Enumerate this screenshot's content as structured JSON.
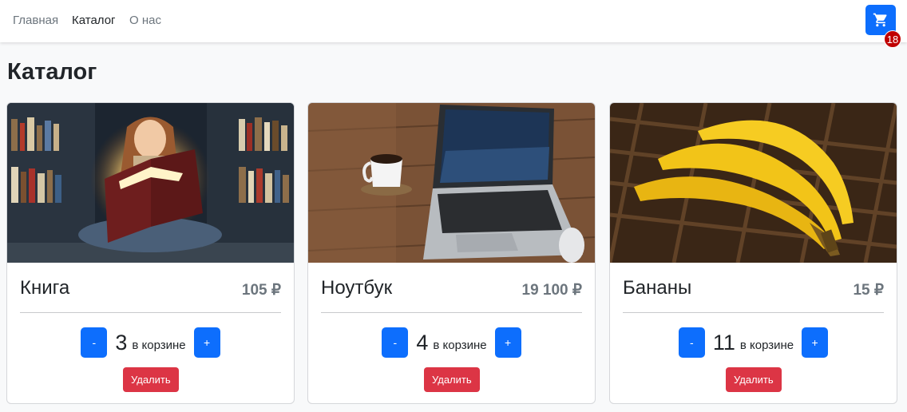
{
  "nav": {
    "links": [
      {
        "label": "Главная",
        "active": false
      },
      {
        "label": "Каталог",
        "active": true
      },
      {
        "label": "О нас",
        "active": false
      }
    ],
    "cart_icon": "shopping-cart-icon",
    "cart_count": "18"
  },
  "page": {
    "title": "Каталог"
  },
  "products": [
    {
      "name": "Книга",
      "price": "105 ₽",
      "image": "girl-reading-glowing-book-photo",
      "minus": "-",
      "qty": "3",
      "qty_label": "в корзине",
      "plus": "+",
      "delete": "Удалить"
    },
    {
      "name": "Ноутбук",
      "price": "19 100 ₽",
      "image": "laptop-coffee-mouse-on-table-photo",
      "minus": "-",
      "qty": "4",
      "qty_label": "в корзине",
      "plus": "+",
      "delete": "Удалить"
    },
    {
      "name": "Бананы",
      "price": "15 ₽",
      "image": "bananas-on-wicker-photo",
      "minus": "-",
      "qty": "11",
      "qty_label": "в корзине",
      "plus": "+",
      "delete": "Удалить"
    }
  ],
  "colors": {
    "primary": "#0d6efd",
    "danger": "#dc3545",
    "badge": "#c00000",
    "price": "#6c757d"
  }
}
